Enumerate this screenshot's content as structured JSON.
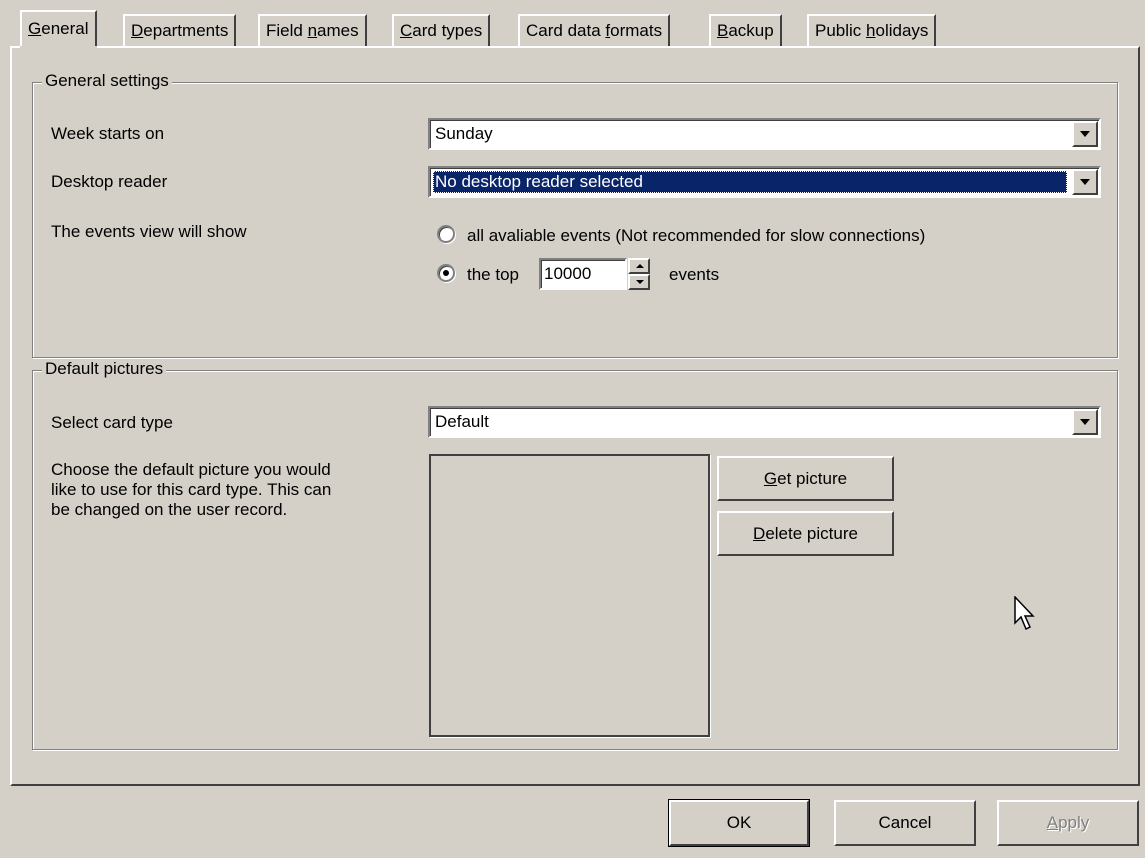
{
  "tabs": [
    {
      "pre": "",
      "key": "G",
      "post": "eneral",
      "active": true
    },
    {
      "pre": "",
      "key": "D",
      "post": "epartments"
    },
    {
      "pre": "Field ",
      "key": "n",
      "post": "ames"
    },
    {
      "pre": "",
      "key": "C",
      "post": "ard types"
    },
    {
      "pre": "Card data ",
      "key": "f",
      "post": "ormats"
    },
    {
      "pre": "",
      "key": "B",
      "post": "ackup"
    },
    {
      "pre": "Public ",
      "key": "h",
      "post": "olidays"
    }
  ],
  "general_settings": {
    "legend": "General settings",
    "week_label": "Week starts on",
    "week_value": "Sunday",
    "reader_label": "Desktop reader",
    "reader_value": "No desktop reader selected",
    "events_label": "The events view will show",
    "radio_all_label": "all avaliable events (Not recommended for slow connections)",
    "radio_top_label": "the top",
    "top_value": "10000",
    "events_suffix": "events",
    "selected_radio": "top"
  },
  "default_pictures": {
    "legend": "Default pictures",
    "card_type_label": "Select card type",
    "card_type_value": "Default",
    "description_line1": "Choose the default picture you would",
    "description_line2": "like to use for this card type. This can",
    "description_line3": "be changed on the user record.",
    "get_picture": {
      "key": "G",
      "post": "et picture"
    },
    "delete_picture": {
      "key": "D",
      "post": "elete picture"
    }
  },
  "buttons": {
    "ok": "OK",
    "cancel": "Cancel",
    "apply_key": "A",
    "apply_post": "pply"
  },
  "icons": {
    "dropdown": "chevron-down-icon",
    "cursor": "mouse-pointer-icon"
  }
}
